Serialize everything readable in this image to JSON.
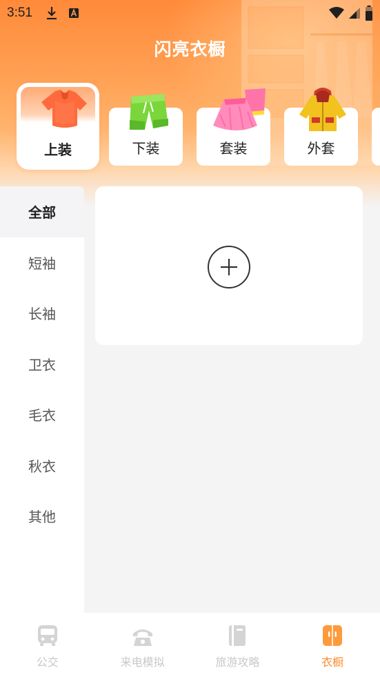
{
  "status_bar": {
    "time": "3:51",
    "left_icons": [
      "download-icon",
      "a-notification-icon"
    ],
    "right_icons": [
      "wifi-icon",
      "signal-icon",
      "battery-icon"
    ]
  },
  "app": {
    "title": "闪亮衣橱"
  },
  "categories": [
    {
      "label": "上装",
      "icon": "tshirt-icon",
      "active": true
    },
    {
      "label": "下装",
      "icon": "shorts-icon",
      "active": false
    },
    {
      "label": "套装",
      "icon": "dress-icon",
      "active": false
    },
    {
      "label": "外套",
      "icon": "jacket-icon",
      "active": false
    }
  ],
  "sidebar": {
    "items": [
      {
        "label": "全部",
        "active": true
      },
      {
        "label": "短袖",
        "active": false
      },
      {
        "label": "长袖",
        "active": false
      },
      {
        "label": "卫衣",
        "active": false
      },
      {
        "label": "毛衣",
        "active": false
      },
      {
        "label": "秋衣",
        "active": false
      },
      {
        "label": "其他",
        "active": false
      }
    ]
  },
  "add_card": {
    "icon": "plus-circle-icon"
  },
  "bottom_nav": {
    "items": [
      {
        "label": "公交",
        "icon": "bus-icon",
        "active": false
      },
      {
        "label": "来电模拟",
        "icon": "phone-icon",
        "active": false
      },
      {
        "label": "旅游攻略",
        "icon": "book-icon",
        "active": false
      },
      {
        "label": "衣橱",
        "icon": "wardrobe-icon",
        "active": true
      }
    ]
  },
  "colors": {
    "accent": "#ff8a2b",
    "header_gradient_top": "#ff8a3a",
    "inactive_nav": "#c8c8c8",
    "background": "#f4f4f4"
  }
}
